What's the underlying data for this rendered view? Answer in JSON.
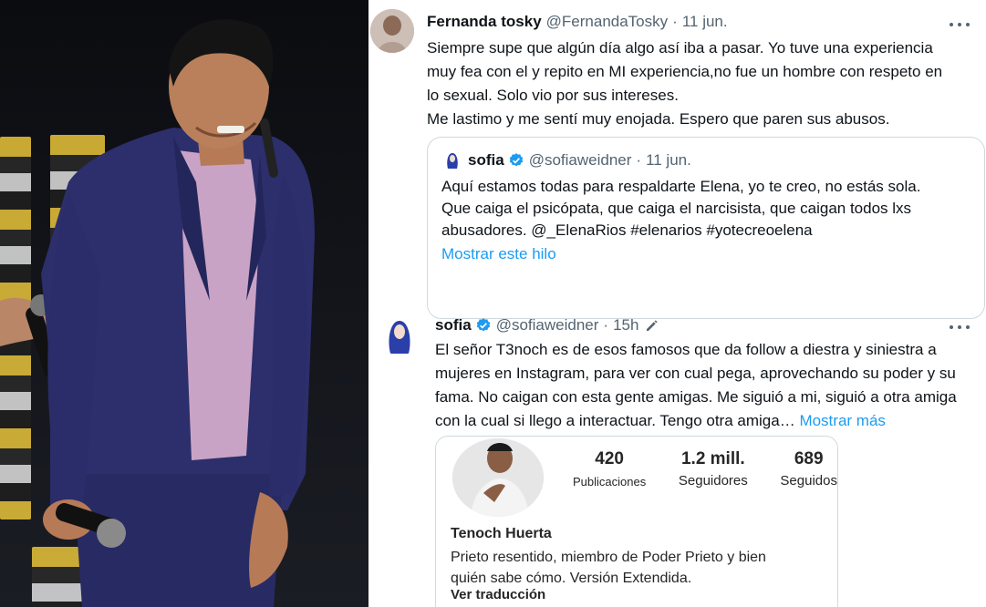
{
  "tweet1": {
    "name": "Fernanda tosky",
    "handle": "@FernandaTosky",
    "separator": "·",
    "date": "11 jun.",
    "lines": [
      "Siempre supe que algún día algo así iba a pasar. Yo tuve una experiencia",
      "muy fea con el y repito en MI experiencia,no fue un hombre con respeto en",
      "lo sexual. Solo vio por sus intereses.",
      "Me lastimo y me sentí muy enojada. Espero que paren sus abusos."
    ],
    "quote": {
      "name": "sofia",
      "handle": "@sofiaweidner",
      "separator": "·",
      "date": "11 jun.",
      "lines": [
        "Aquí estamos todas para respaldarte Elena, yo te creo, no estás sola.",
        "Que caiga el psicópata, que caiga el narcisista, que caigan todos lxs",
        "abusadores. @_ElenaRios #elenarios #yotecreoelena"
      ],
      "show_thread": "Mostrar este hilo"
    }
  },
  "tweet2": {
    "name": "sofia",
    "handle": "@sofiaweidner",
    "separator": "·",
    "date": "15h",
    "lines": [
      "El señor T3noch es de esos famosos que da follow a diestra y siniestra a",
      "mujeres en Instagram, para ver con cual pega, aprovechando su poder y su",
      "fama. No caigan con esta gente amigas. Me siguió a mi, siguió a otra amiga",
      "con la cual si llego a interactuar. Tengo otra amiga…"
    ],
    "show_more": "Mostrar más",
    "instagram": {
      "posts": "420",
      "posts_label": "Publicaciones",
      "followers": "1.2 mill.",
      "followers_label": "Seguidores",
      "following": "689",
      "following_label": "Seguidos",
      "name": "Tenoch Huerta",
      "bio_lines": [
        "Prieto resentido, miembro de Poder Prieto y bien",
        "quién sabe cómo. Versión Extendida."
      ],
      "translate": "Ver traducción"
    }
  },
  "colors": {
    "link": "#1d9bf0",
    "verified": "#1d9bf0",
    "muted": "#536471",
    "text": "#0f1419",
    "border": "#cfd9de"
  }
}
